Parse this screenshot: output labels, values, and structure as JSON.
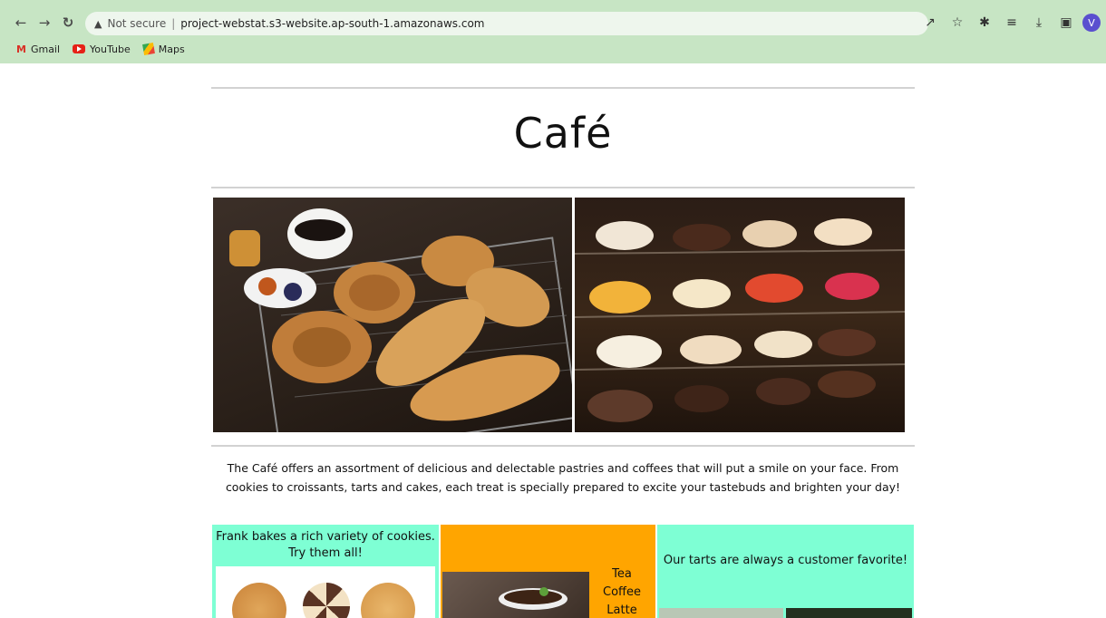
{
  "browser": {
    "security_label": "Not secure",
    "url": "project-webstat.s3-website.ap-south-1.amazonaws.com",
    "avatar_initial": "V",
    "bookmarks": [
      {
        "label": "Gmail",
        "icon": "gmail-icon"
      },
      {
        "label": "YouTube",
        "icon": "youtube-icon"
      },
      {
        "label": "Maps",
        "icon": "maps-icon"
      }
    ]
  },
  "page": {
    "title": "Café",
    "description": "The Café offers an assortment of delicious and delectable pastries and coffees that will put a smile on your face. From cookies to croissants, tarts and cakes, each treat is specially prepared to excite your tastebuds and brighten your day!",
    "cards": {
      "cookies": "Frank bakes a rich variety of cookies. Try them all!",
      "drinks": [
        "Tea",
        "Coffee",
        "Latte"
      ],
      "tarts": "Our tarts are always a customer favorite!"
    }
  },
  "colors": {
    "chrome": "#c7e5c4",
    "card_mint": "#7effd4",
    "card_orange": "#ffa500"
  }
}
